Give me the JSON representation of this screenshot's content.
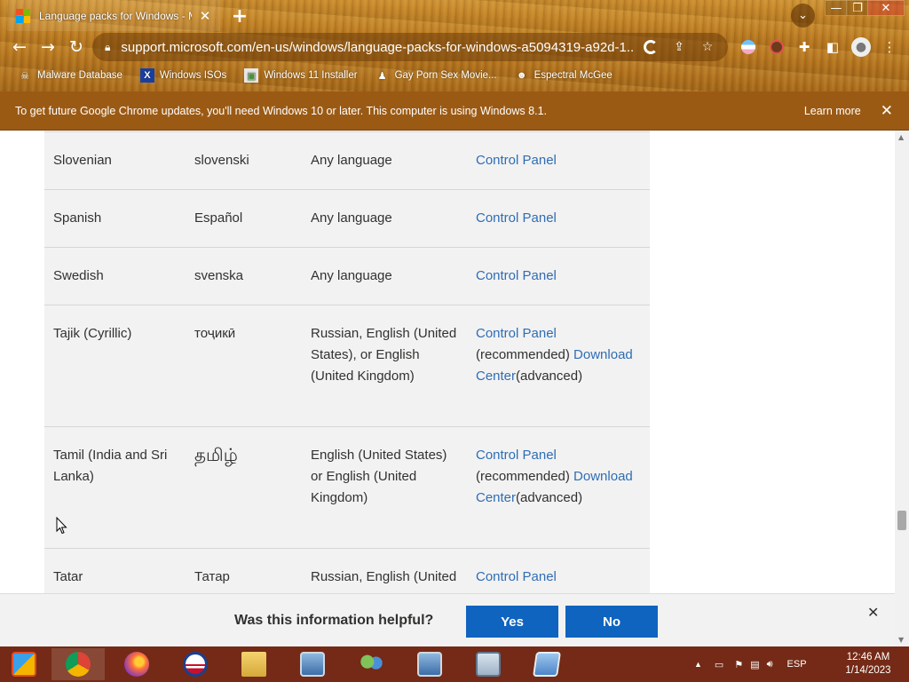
{
  "browser": {
    "tab_title": "Language packs for Windows - Mi",
    "tab_close": "✕",
    "new_tab": "+",
    "url": "support.microsoft.com/en-us/windows/language-packs-for-windows-a5094319-a92d-1...",
    "bookmarks": [
      {
        "label": "Malware Database",
        "icon": "skull-icon"
      },
      {
        "label": "Windows ISOs",
        "icon": "x-logo-icon"
      },
      {
        "label": "Windows 11 Installer",
        "icon": "image-icon"
      },
      {
        "label": "Gay Porn Sex Movie...",
        "icon": "figure-icon"
      },
      {
        "label": "Espectral McGee",
        "icon": "mask-icon"
      }
    ]
  },
  "infobar": {
    "message": "To get future Google Chrome updates, you'll need Windows 10 or later. This computer is using Windows 8.1.",
    "learn_more": "Learn more"
  },
  "table": {
    "rows": [
      {
        "language": "Slovenian",
        "native": "slovenski",
        "base": "Any language",
        "link1": "Control Panel",
        "suffix1": "",
        "link2": "",
        "suffix2": ""
      },
      {
        "language": "Spanish",
        "native": "Español",
        "base": "Any language",
        "link1": "Control Panel",
        "suffix1": "",
        "link2": "",
        "suffix2": ""
      },
      {
        "language": "Swedish",
        "native": "svenska",
        "base": "Any language",
        "link1": "Control Panel",
        "suffix1": "",
        "link2": "",
        "suffix2": ""
      },
      {
        "language": "Tajik (Cyrillic)",
        "native": "тоҷикӣ",
        "base": "Russian, English (United States), or English (United Kingdom)",
        "link1": "Control Panel",
        "suffix1": "(recommended)",
        "link2": "Download Center",
        "suffix2": "(advanced)"
      },
      {
        "language": "Tamil (India and Sri Lanka)",
        "native": "தமிழ்",
        "base": "English (United States) or English (United Kingdom)",
        "link1": "Control Panel",
        "suffix1": "(recommended)",
        "link2": "Download Center",
        "suffix2": "(advanced)"
      },
      {
        "language": "Tatar",
        "native": "Татар",
        "base": "Russian, English (United",
        "link1": "Control Panel",
        "suffix1": "",
        "link2": "",
        "suffix2": ""
      }
    ]
  },
  "feedback": {
    "question": "Was this information helpful?",
    "yes": "Yes",
    "no": "No"
  },
  "taskbar": {
    "language": "ESP",
    "time": "12:46 AM",
    "date": "1/14/2023"
  }
}
